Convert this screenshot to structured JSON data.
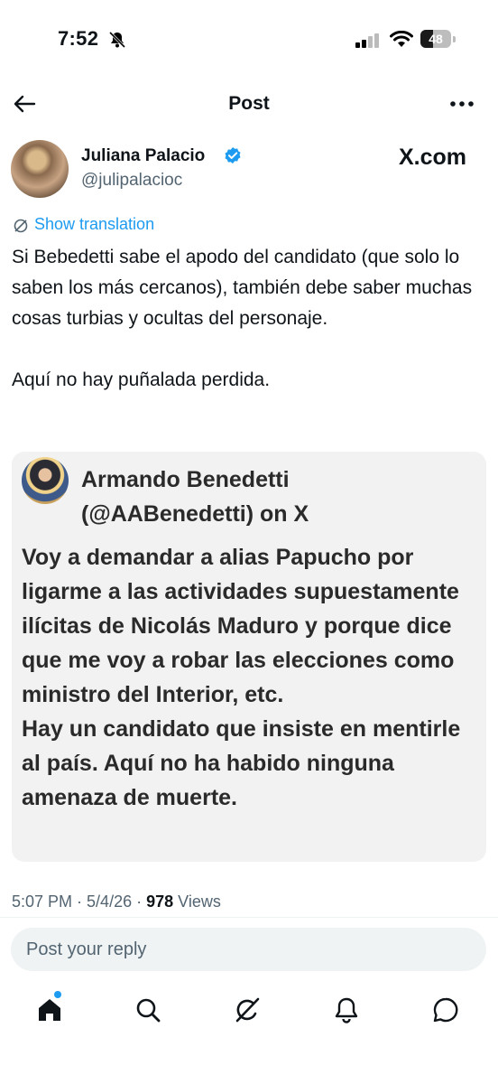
{
  "status_bar": {
    "time": "7:52",
    "battery": "48"
  },
  "header": {
    "title": "Post"
  },
  "author": {
    "name": "Juliana Palacio",
    "handle": "@julipalacioc",
    "source": "X.com"
  },
  "translation": {
    "label": "Show translation"
  },
  "post": {
    "paragraph1": "Si Bebedetti sabe el apodo del candidato (que solo lo saben los más cercanos), también debe saber muchas cosas turbias y ocultas del personaje.",
    "paragraph2": "Aquí no hay puñalada perdida."
  },
  "quoted": {
    "author_line1": "Armando Benedetti",
    "author_line2": "(@AABenedetti) on X",
    "text1": "Voy a demandar a alias Papucho por ligarme a las actividades supuestamente ilícitas de Nicolás Maduro y porque dice que me voy a robar las elecciones como ministro del Interior, etc.",
    "text2": "Hay un candidato que insiste en mentirle al país. Aquí no ha habido ninguna amenaza de muerte."
  },
  "meta": {
    "time": "5:07 PM",
    "separator": " · ",
    "date": "5/4/26",
    "views_count": "978",
    "views_label": "Views"
  },
  "reply": {
    "placeholder": "Post your reply"
  },
  "nav": {
    "items": [
      "home-icon",
      "search-icon",
      "grok-icon",
      "notifications-icon",
      "messages-icon"
    ]
  },
  "colors": {
    "accent": "#1d9bf0",
    "text": "#0f1419",
    "secondary": "#536471",
    "card": "#f2f2f2"
  }
}
